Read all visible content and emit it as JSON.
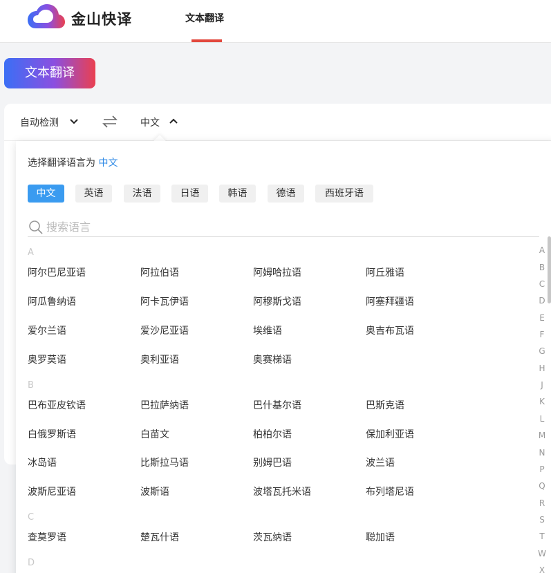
{
  "header": {
    "brand": "金山快译",
    "nav_tab": "文本翻译",
    "accent": "#e2483d"
  },
  "translate_button": "文本翻译",
  "lang_bar": {
    "source": "自动检测",
    "target": "中文"
  },
  "dropdown": {
    "prompt_prefix": "选择翻译语言为",
    "current": "中文",
    "chips": [
      "中文",
      "英语",
      "法语",
      "日语",
      "韩语",
      "德语",
      "西班牙语"
    ],
    "active_chip": "中文",
    "search_placeholder": "搜索语言",
    "groups": [
      {
        "letter": "A",
        "items": [
          "阿尔巴尼亚语",
          "阿拉伯语",
          "阿姆哈拉语",
          "阿丘雅语",
          "阿瓜鲁纳语",
          "阿卡瓦伊语",
          "阿穆斯戈语",
          "阿塞拜疆语",
          "爱尔兰语",
          "爱沙尼亚语",
          "埃维语",
          "奥吉布瓦语",
          "奥罗莫语",
          "奥利亚语",
          "奥赛梯语"
        ]
      },
      {
        "letter": "B",
        "items": [
          "巴布亚皮钦语",
          "巴拉萨纳语",
          "巴什基尔语",
          "巴斯克语",
          "白俄罗斯语",
          "白苗文",
          "柏柏尔语",
          "保加利亚语",
          "冰岛语",
          "比斯拉马语",
          "别姆巴语",
          "波兰语",
          "波斯尼亚语",
          "波斯语",
          "波塔瓦托米语",
          "布列塔尼语"
        ]
      },
      {
        "letter": "C",
        "items": [
          "查莫罗语",
          "楚瓦什语",
          "茨瓦纳语",
          "聪加语"
        ]
      },
      {
        "letter": "D",
        "items": []
      }
    ],
    "alphabet": [
      "A",
      "B",
      "C",
      "D",
      "E",
      "F",
      "G",
      "H",
      "J",
      "K",
      "L",
      "M",
      "N",
      "P",
      "Q",
      "R",
      "S",
      "T",
      "W",
      "X"
    ]
  }
}
